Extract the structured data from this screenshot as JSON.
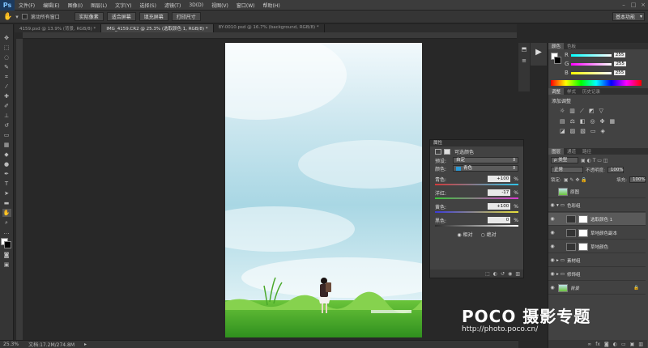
{
  "app": {
    "logo": "Ps"
  },
  "menu": [
    "文件(F)",
    "编辑(E)",
    "图像(I)",
    "图层(L)",
    "文字(Y)",
    "选择(S)",
    "滤镜(T)",
    "3D(D)",
    "视图(V)",
    "窗口(W)",
    "帮助(H)"
  ],
  "options": {
    "scroll_all_label": "滚动所有窗口",
    "btn_actual": "实际像素",
    "btn_fit": "适合屏幕",
    "btn_fill": "填充屏幕",
    "btn_print": "打印尺寸",
    "workspace": "基本功能"
  },
  "tabs": [
    {
      "label": "4159.psd @ 13.9% (背景, RGB/8) *",
      "active": false
    },
    {
      "label": "IMG_4159.CR2 @ 25.3% (选取颜色 1, RGB/8) *",
      "active": true
    },
    {
      "label": "8Y-0010.psd @ 16.7% (background, RGB/8) *",
      "active": false
    }
  ],
  "status": {
    "zoom": "25.3%",
    "doc": "文档:17.2M/274.8M"
  },
  "watermark": {
    "logo": "POCO 摄影专题",
    "url": "http://photo.poco.cn/"
  },
  "properties": {
    "tab": "属性",
    "title": "可选颜色",
    "preset_label": "预设:",
    "preset_value": "自定",
    "colors_label": "颜色:",
    "colors_value": "青色",
    "sliders": [
      {
        "label": "青色:",
        "value": "+100",
        "unit": "%"
      },
      {
        "label": "洋红:",
        "value": "-17",
        "unit": "%"
      },
      {
        "label": "黄色:",
        "value": "+100",
        "unit": "%"
      },
      {
        "label": "黑色:",
        "value": "0",
        "unit": "%"
      }
    ],
    "mode_relative": "相对",
    "mode_absolute": "绝对"
  },
  "color_panel": {
    "tabs": [
      "颜色",
      "色板"
    ],
    "r": "255",
    "g": "255",
    "b": "255",
    "r_label": "R",
    "g_label": "G",
    "b_label": "B"
  },
  "adjust_panel": {
    "tabs": [
      "调整",
      "样式",
      "历史记录"
    ],
    "title": "添加调整"
  },
  "layers_panel": {
    "tabs": [
      "图层",
      "通道",
      "路径"
    ],
    "kind": "ρ 类型",
    "blend": "正常",
    "opacity_label": "不透明度:",
    "opacity": "100%",
    "lock_label": "锁定:",
    "fill_label": "填充:",
    "fill": "100%",
    "layers": [
      {
        "name": "原图"
      },
      {
        "name": "色彩组"
      },
      {
        "name": "选取颜色 1"
      },
      {
        "name": "草地颜色副本"
      },
      {
        "name": "草地颜色"
      },
      {
        "name": "素材组"
      },
      {
        "name": "修饰组"
      },
      {
        "name": "背景"
      }
    ]
  },
  "colors": {
    "accent": "#1c3a5e",
    "slider_selected": "#2a9bd8"
  }
}
